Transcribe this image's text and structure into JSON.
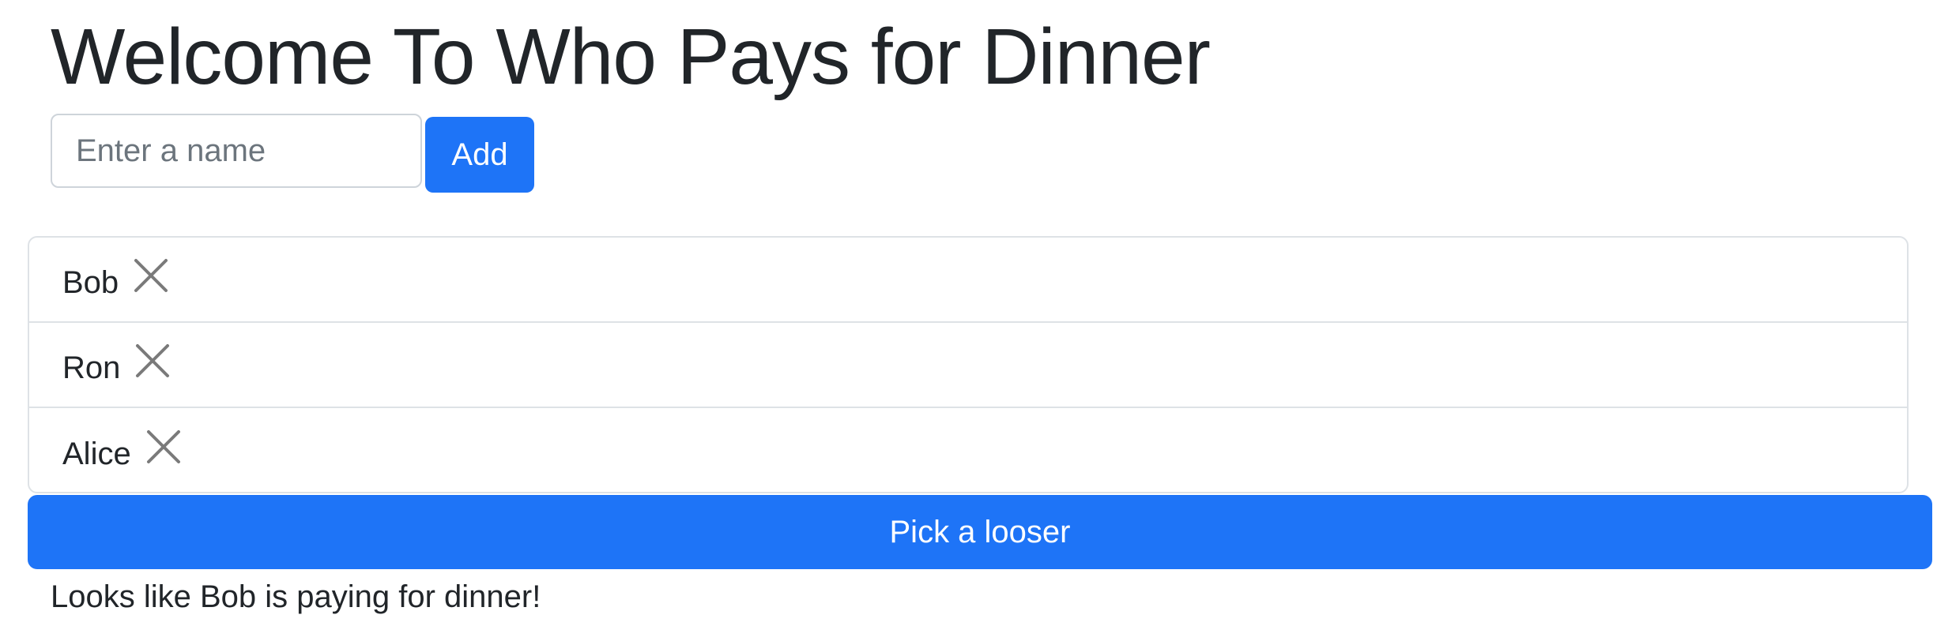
{
  "title": "Welcome To Who Pays for Dinner",
  "form": {
    "input_value": "",
    "input_placeholder": "Enter a name",
    "add_label": "Add"
  },
  "names": [
    {
      "label": "Bob",
      "remove_icon": "close-icon"
    },
    {
      "label": "Ron",
      "remove_icon": "close-icon"
    },
    {
      "label": "Alice",
      "remove_icon": "close-icon"
    }
  ],
  "pick_label": "Pick a looser",
  "result_text": "Looks like Bob is paying for dinner!",
  "colors": {
    "primary": "#1e74f7",
    "text": "#212529",
    "border": "#dee2e6",
    "icon": "#7a7a7a"
  }
}
